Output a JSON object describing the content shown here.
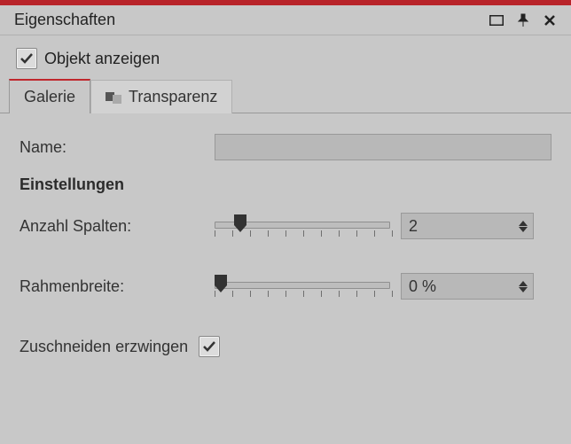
{
  "panel": {
    "title": "Eigenschaften"
  },
  "showObject": {
    "label": "Objekt anzeigen",
    "checked": true
  },
  "tabs": {
    "galerie": "Galerie",
    "transparenz": "Transparenz"
  },
  "fields": {
    "name": {
      "label": "Name:",
      "value": ""
    },
    "sectionTitle": "Einstellungen",
    "columns": {
      "label": "Anzahl Spalten:",
      "value": "2",
      "sliderPos": 0.12
    },
    "border": {
      "label": "Rahmenbreite:",
      "value": "0 %",
      "sliderPos": 0.0
    },
    "crop": {
      "label": "Zuschneiden erzwingen",
      "checked": true
    }
  }
}
